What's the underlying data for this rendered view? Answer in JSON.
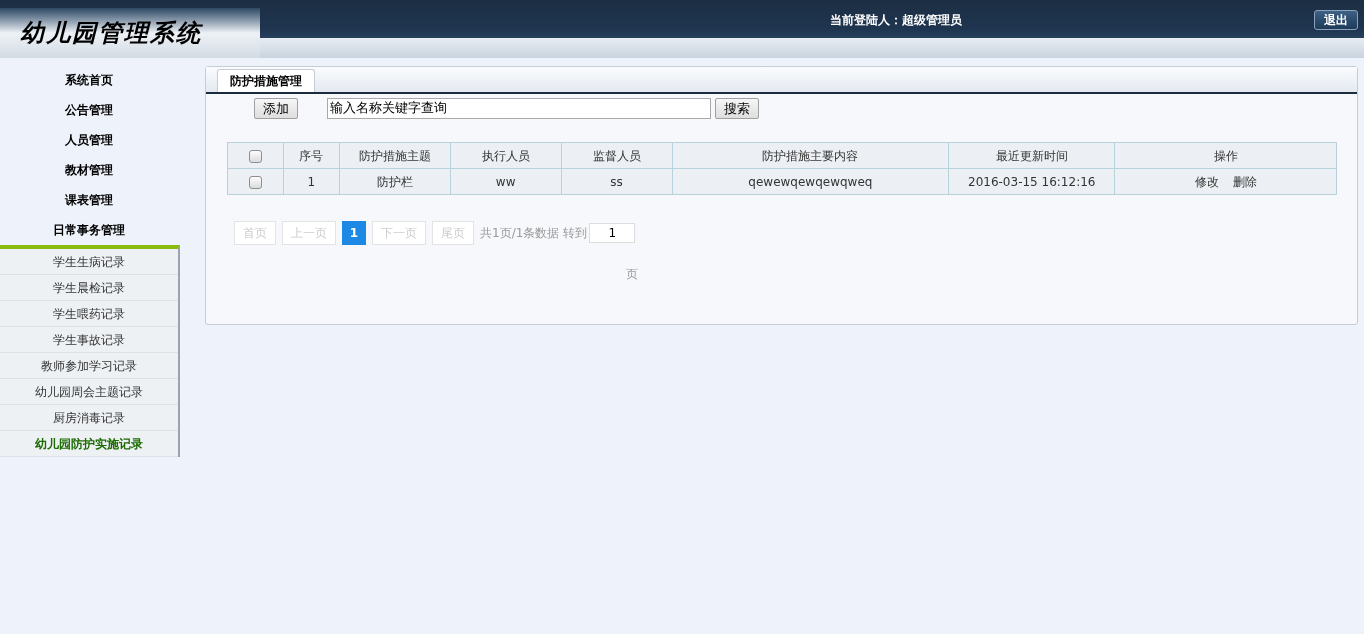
{
  "header": {
    "logo": "幼儿园管理系统",
    "current_user_label": "当前登陆人：",
    "current_user": "超级管理员",
    "logout": "退出"
  },
  "sidebar": {
    "items": [
      {
        "label": "系统首页"
      },
      {
        "label": "公告管理"
      },
      {
        "label": "人员管理"
      },
      {
        "label": "教材管理"
      },
      {
        "label": "课表管理"
      },
      {
        "label": "日常事务管理",
        "children": [
          {
            "label": "学生生病记录",
            "selected": false
          },
          {
            "label": "学生晨检记录",
            "selected": false
          },
          {
            "label": "学生喂药记录",
            "selected": false
          },
          {
            "label": "学生事故记录",
            "selected": false
          },
          {
            "label": "教师参加学习记录",
            "selected": false
          },
          {
            "label": "幼儿园周会主题记录",
            "selected": false
          },
          {
            "label": "厨房消毒记录",
            "selected": false
          },
          {
            "label": "幼儿园防护实施记录",
            "selected": true
          }
        ]
      }
    ]
  },
  "panel": {
    "tab": "防护措施管理",
    "add_button": "添加",
    "search_value": "输入名称关键字查询",
    "search_button": "搜索"
  },
  "table": {
    "columns": [
      "序号",
      "防护措施主题",
      "执行人员",
      "监督人员",
      "防护措施主要内容",
      "最近更新时间",
      "操作"
    ],
    "rows": [
      {
        "checked": false,
        "cells": [
          "1",
          "防护栏",
          "ww",
          "ss",
          "qewewqewqewqweq",
          "2016-03-15 16:12:16"
        ],
        "actions": [
          "修改",
          "删除"
        ]
      }
    ],
    "header_checked": false
  },
  "pagination": {
    "first": "首页",
    "prev": "上一页",
    "pages": [
      {
        "label": "1",
        "selected": true
      }
    ],
    "next": "下一页",
    "last": "尾页",
    "summary": "共1页/1条数据",
    "goto_label": "转到",
    "goto_value": "1",
    "page_suffix": "页"
  }
}
